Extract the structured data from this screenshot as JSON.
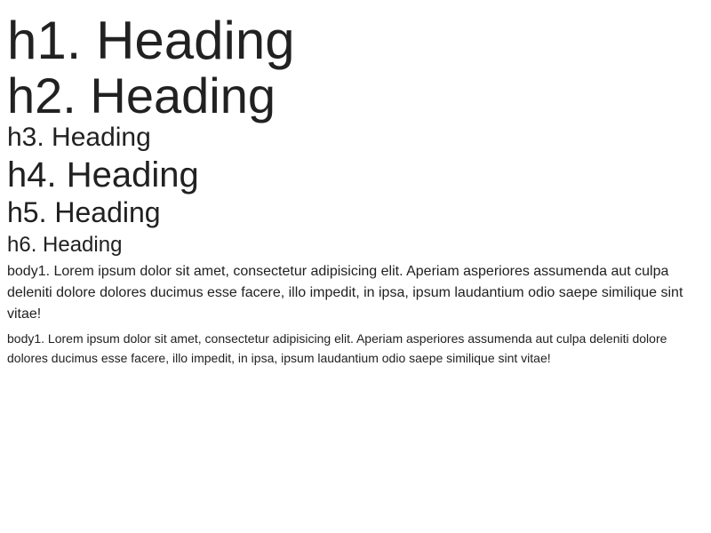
{
  "typography": {
    "h1": "h1. Heading",
    "h2": "h2. Heading",
    "h3": "h3. Heading",
    "h4": "h4. Heading",
    "h5": "h5. Heading",
    "h6": "h6. Heading",
    "body1": "body1. Lorem ipsum dolor sit amet, consectetur adipisicing elit. Aperiam asperiores assumenda aut culpa deleniti dolore dolores ducimus esse facere, illo impedit, in ipsa, ipsum laudantium odio saepe similique sint vitae!",
    "body2": "body1. Lorem ipsum dolor sit amet, consectetur adipisicing elit. Aperiam asperiores assumenda aut culpa deleniti dolore dolores ducimus esse facere, illo impedit, in ipsa, ipsum laudantium odio saepe similique sint vitae!"
  },
  "colors": {
    "text": "#212121",
    "background": "#ffffff"
  }
}
